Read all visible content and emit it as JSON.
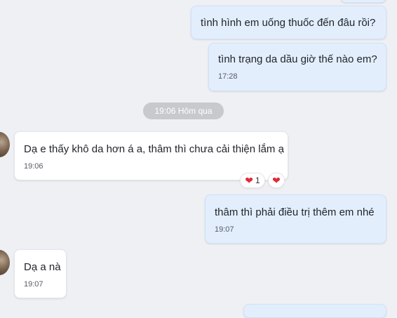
{
  "messages": [
    {
      "text": "tình hình em uống thuốc đến đâu rồi?"
    },
    {
      "text": "tình trạng da dầu giờ thế nào em?",
      "time": "17:28"
    },
    {
      "text": "Dạ e thấy khô da hơn á a, thâm thì chưa cải thiện lắm ạ",
      "time": "19:06"
    },
    {
      "text": "thâm thì phải điều trị thêm em nhé",
      "time": "19:07"
    },
    {
      "text": "Dạ a nà",
      "time": "19:07"
    }
  ],
  "day_separator": "19:06 Hôm qua",
  "reactions": {
    "heart_icon": "heart-icon",
    "heart_color": "#e0293a",
    "count": "1"
  },
  "colors": {
    "outgoing_bubble": "#e3eefd",
    "incoming_bubble": "#ffffff",
    "background": "#eef0f4"
  }
}
